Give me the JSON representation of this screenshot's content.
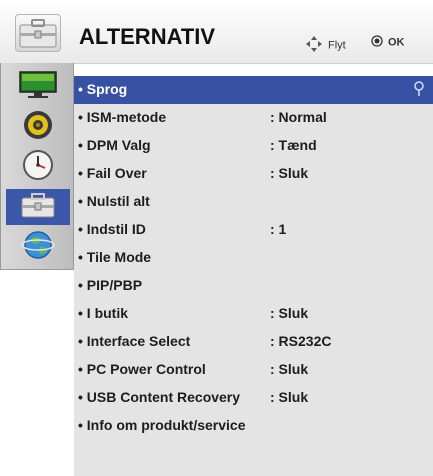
{
  "header": {
    "title": "ALTERNATIV",
    "move_label": "Flyt",
    "ok_label": "OK",
    "icon": "toolbox-icon"
  },
  "sidebar": {
    "items": [
      {
        "name": "picture",
        "icon": "monitor-icon"
      },
      {
        "name": "audio",
        "icon": "speaker-icon"
      },
      {
        "name": "time",
        "icon": "clock-icon"
      },
      {
        "name": "option",
        "icon": "toolbox-icon",
        "active": true
      },
      {
        "name": "network",
        "icon": "globe-icon"
      }
    ]
  },
  "menu": {
    "items": [
      {
        "label": "• Sprog",
        "value": ""
      },
      {
        "label": "• ISM-metode",
        "value": ": Normal"
      },
      {
        "label": "• DPM Valg",
        "value": ": Tænd"
      },
      {
        "label": "• Fail Over",
        "value": ": Sluk"
      },
      {
        "label": "• Nulstil alt",
        "value": ""
      },
      {
        "label": "• Indstil ID",
        "value": ": 1"
      },
      {
        "label": "• Tile Mode",
        "value": ""
      },
      {
        "label": "• PIP/PBP",
        "value": ""
      },
      {
        "label": "• I butik",
        "value": ": Sluk"
      },
      {
        "label": "• Interface Select",
        "value": ": RS232C"
      },
      {
        "label": "• PC Power Control",
        "value": ": Sluk"
      },
      {
        "label": "• USB Content Recovery",
        "value": ": Sluk"
      },
      {
        "label": "• Info om produkt/service",
        "value": ""
      }
    ]
  },
  "colors": {
    "selected_row": "#3851a3",
    "menu_bg": "#e4e4e4",
    "sidebar_active": "#3c57a7"
  }
}
